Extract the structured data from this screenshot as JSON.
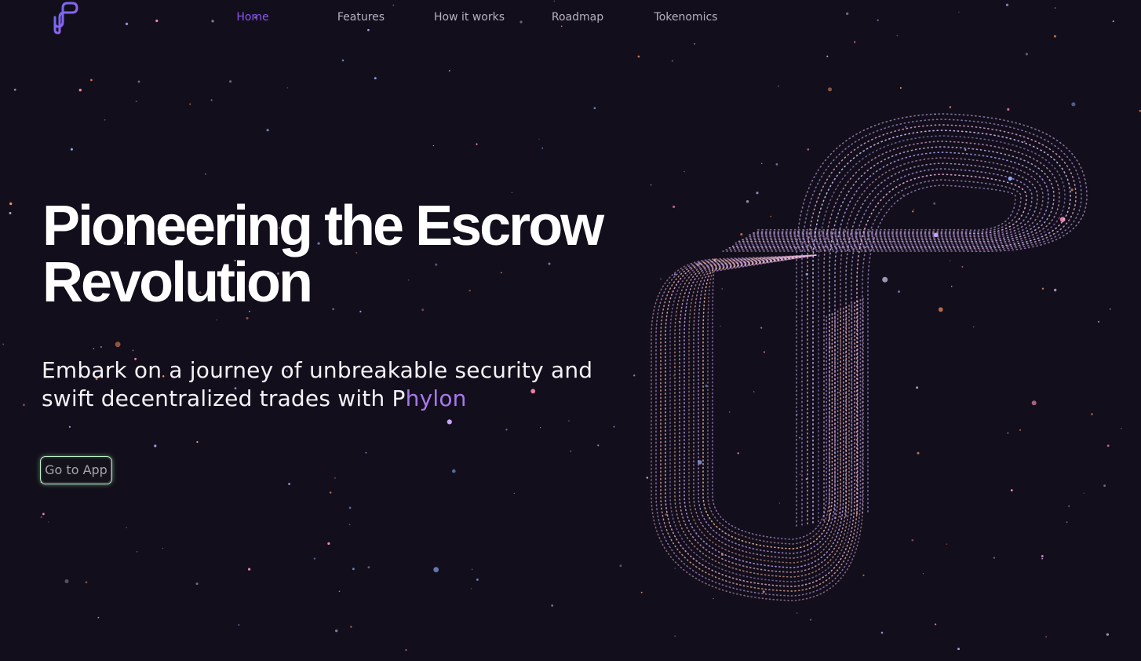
{
  "nav": {
    "items": [
      {
        "label": "Home",
        "active": true
      },
      {
        "label": "Features",
        "active": false
      },
      {
        "label": "How it works",
        "active": false
      },
      {
        "label": "Roadmap",
        "active": false
      },
      {
        "label": "Tokenomics",
        "active": false
      }
    ]
  },
  "hero": {
    "title_line1": "Pioneering the Escrow",
    "title_line2": "Revolution",
    "subtitle_line1": "Embark on a journey of unbreakable security and",
    "subtitle_line2_prefix": "swift decentralized trades with ",
    "brand_first_letter": "P",
    "brand_rest": "hylon",
    "cta_label": "Go to App"
  },
  "theme": {
    "background": "#130e1b",
    "accent": "#8a56f0",
    "brand_gradient": "#a679ec",
    "cta_glow": "#b9f3c7"
  },
  "icons": {
    "logo": "phylon-logo-icon",
    "hero_mark": "phylon-particle-logo"
  }
}
